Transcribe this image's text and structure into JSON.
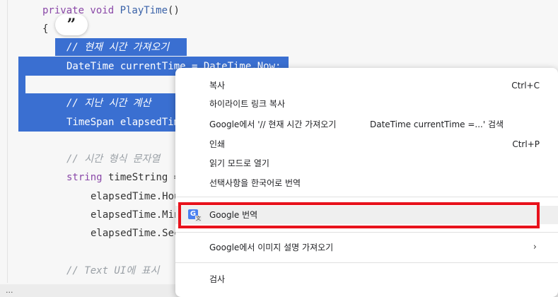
{
  "code": {
    "quote_icon": "”",
    "lines": [
      {
        "kw": "private void ",
        "fn": "PlayTime",
        "rest": "()"
      },
      {
        "text": "{"
      },
      {
        "comment": "// 현재 시간 가져오기"
      },
      {
        "text": "DateTime currentTime = DateTime.Now;"
      },
      {
        "comment": "// 지난 시간 계산"
      },
      {
        "text": "TimeSpan elapsedTim"
      },
      {
        "comment": "// 시간 형식 문자열"
      },
      {
        "kw": "string ",
        "rest": "timeString ="
      },
      {
        "text": "elapsedTime.Hou"
      },
      {
        "text": "elapsedTime.Min"
      },
      {
        "text": "elapsedTime.Sec"
      },
      {
        "comment": "// Text UI에 표시"
      }
    ],
    "status_text": "..."
  },
  "context_menu": {
    "items": [
      {
        "label": "복사",
        "shortcut": "Ctrl+C"
      },
      {
        "label": "하이라이트 링크 복사"
      },
      {
        "label": "Google에서 '// 현재 시간 가져오기",
        "label2": "DateTime currentTime =...' 검색"
      },
      {
        "label": "인쇄",
        "shortcut": "Ctrl+P"
      },
      {
        "label": "읽기 모드로 열기"
      },
      {
        "label": "선택사항을 한국어로 번역"
      },
      {
        "label": "Google 번역",
        "icon": "google-translate-icon"
      },
      {
        "label": "Google에서 이미지 설명 가져오기",
        "arrow": "›"
      },
      {
        "label": "검사"
      }
    ]
  },
  "colors": {
    "selection": "#3a6fd1",
    "highlight_box": "#e8121c"
  }
}
